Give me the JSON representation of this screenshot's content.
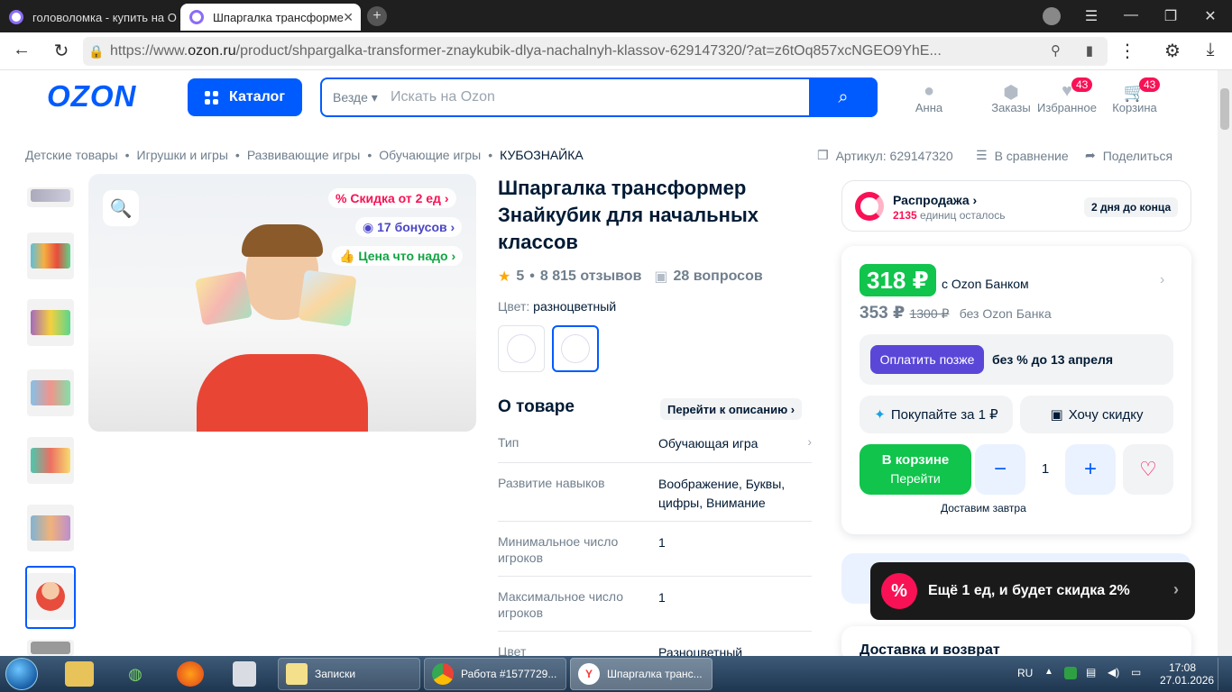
{
  "browser": {
    "tabs": [
      {
        "label": "головоломка - купить на О"
      },
      {
        "label": "Шпаргалка трансформе"
      }
    ],
    "url_prefix": "https://www.",
    "url_domain": "ozon.ru",
    "url_rest": "/product/shpargalka-transformer-znaykubik-dlya-nachalnyh-klassov-629147320/?at=z6tOq857xcNGEO9YhE..."
  },
  "header": {
    "logo": "OZON",
    "catalog_label": "Каталог",
    "search_scope": "Везде",
    "search_placeholder": "Искать на Ozon",
    "user_label": "Анна",
    "orders_label": "Заказы",
    "favorites_label": "Избранное",
    "favorites_count": "43",
    "cart_label": "Корзина",
    "cart_count": "43"
  },
  "breadcrumbs": [
    "Детские товары",
    "Игрушки и игры",
    "Развивающие игры",
    "Обучающие игры",
    "КУБОЗНАЙКА"
  ],
  "breadcrumb_sep": "•",
  "actions": {
    "article": "Артикул: 629147320",
    "compare": "В сравнение",
    "share": "Поделиться"
  },
  "promos": {
    "discount": "Скидка от 2 ед",
    "bonus": "17 бонусов",
    "price_tag": "Цена что надо"
  },
  "product": {
    "title": "Шпаргалка трансформер Знайкубик для начальных классов",
    "rating": "5",
    "reviews": "8 815 отзывов",
    "questions": "28 вопросов",
    "color_label": "Цвет:",
    "color_value": "разноцветный",
    "about_title": "О товаре",
    "go_desc": "Перейти к описанию",
    "specs": [
      {
        "key": "Тип",
        "value": "Обучающая игра"
      },
      {
        "key": "Развитие навыков",
        "value": "Воображение, Буквы, цифры, Внимание"
      },
      {
        "key": "Минимальное число игроков",
        "value": "1"
      },
      {
        "key": "Максимальное число игроков",
        "value": "1"
      },
      {
        "key": "Цвет",
        "value": "Разноцветный"
      }
    ]
  },
  "sale": {
    "title": "Распродажа",
    "left_count": "2135",
    "left_text": "единиц осталось",
    "days": "2 дня до конца"
  },
  "price": {
    "ozon_bank": "318 ₽",
    "ozon_bank_label": "с Ozon Банком",
    "regular": "353 ₽",
    "old": "1300 ₽",
    "regular_label": "без Ozon Банка",
    "pay_later_btn": "Оплатить позже",
    "pay_later_text": "без % до 13 апреля",
    "buy_for_1": "Покупайте за 1 ₽",
    "want_discount": "Хочу скидку",
    "in_cart": "В корзине",
    "go": "Перейти",
    "minus": "−",
    "qty": "1",
    "plus": "+",
    "delivery": "Доставим завтра",
    "delivery_return": "Доставка и возврат"
  },
  "toast": {
    "pct": "%",
    "text": "Ещё 1 ед, и будет скидка 2%"
  },
  "taskbar": {
    "notes": "Записки",
    "chrome_task": "Работа #1577729...",
    "yandex_task": "Шпаргалка транс...",
    "lang": "RU",
    "time": "17:08",
    "date": "27.01.2026"
  },
  "colors": {
    "accent": "#005bff",
    "green": "#10c44c",
    "pink": "#f91155"
  }
}
